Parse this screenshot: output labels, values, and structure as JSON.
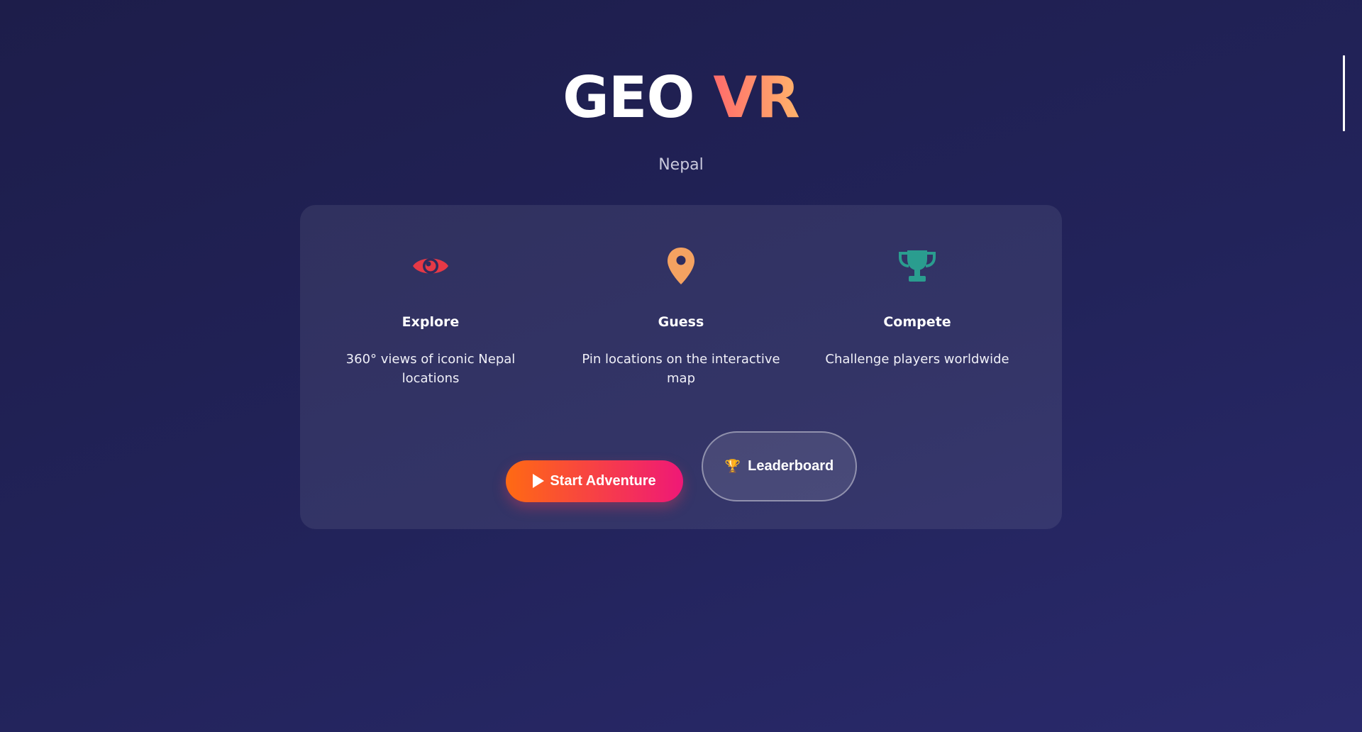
{
  "header": {
    "title_part1": "GEO",
    "title_part2": "VR",
    "subtitle": "Nepal"
  },
  "features": [
    {
      "icon": "eye-icon",
      "title": "Explore",
      "description": "360° views of iconic Nepal locations",
      "color": "#e63946"
    },
    {
      "icon": "map-pin-icon",
      "title": "Guess",
      "description": "Pin locations on the interactive map",
      "color": "#f4a261"
    },
    {
      "icon": "trophy-icon",
      "title": "Compete",
      "description": "Challenge players worldwide",
      "color": "#2a9d8f"
    }
  ],
  "actions": {
    "start_label": "Start Adventure",
    "leaderboard_icon": "🏆",
    "leaderboard_label": "Leaderboard"
  },
  "colors": {
    "background_top": "#1d1d4a",
    "background_bottom": "#2a2a6c",
    "accent_gradient_start": "#ff6b6b",
    "accent_gradient_end": "#ffb36b",
    "button_gradient_start": "#ff6a13",
    "button_gradient_end": "#ef1877"
  }
}
